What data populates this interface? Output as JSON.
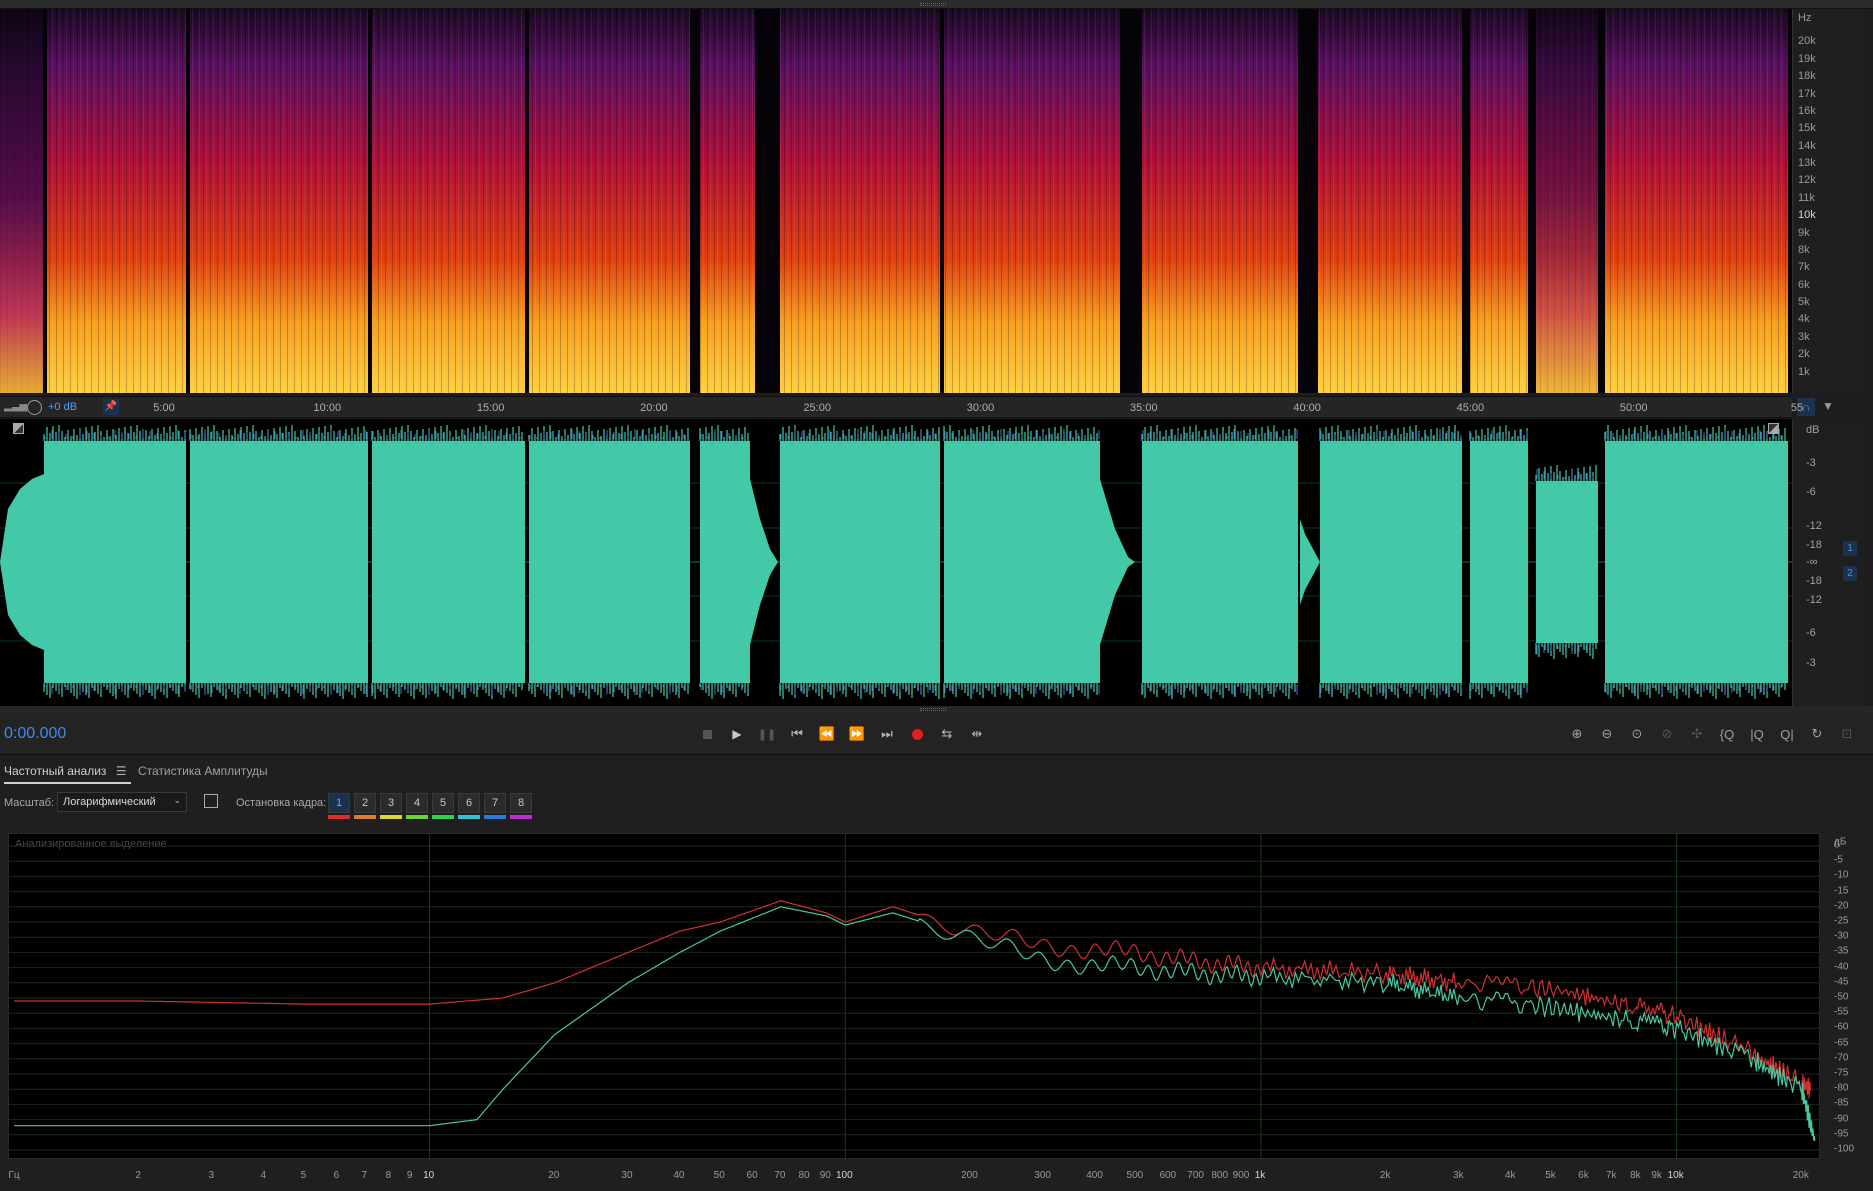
{
  "spectral_view": {
    "hz_unit": "Hz",
    "hz_ticks": [
      "20k",
      "19k",
      "18k",
      "17k",
      "16k",
      "15k",
      "14k",
      "13k",
      "12k",
      "11k",
      "10k",
      "9k",
      "8k",
      "7k",
      "6k",
      "5k",
      "4k",
      "3k",
      "2k",
      "1k"
    ]
  },
  "timeline": {
    "gain_label": "+0 dB",
    "ticks": [
      "5:00",
      "10:00",
      "15:00",
      "20:00",
      "25:00",
      "30:00",
      "35:00",
      "40:00",
      "45:00",
      "50:00",
      "55"
    ]
  },
  "waveform": {
    "db_unit": "dB",
    "db_ticks": [
      "-3",
      "-6",
      "-12",
      "-18",
      "-∞",
      "-18",
      "-12",
      "-6",
      "-3"
    ],
    "channels": [
      "1",
      "2"
    ],
    "color": "#43c8a8"
  },
  "transport": {
    "current_time": "0:00.000",
    "buttons": [
      "stop-icon",
      "play-icon",
      "pause-icon",
      "go-to-start-icon",
      "rewind-icon",
      "fast-forward-icon",
      "go-to-end-icon",
      "record-icon",
      "loop-icon",
      "skip-selection-icon"
    ],
    "zoom_buttons": [
      "zoom-in-amplitude-icon",
      "zoom-out-amplitude-icon",
      "zoom-full-icon",
      "zoom-in-time-icon",
      "zoom-out-time-icon",
      "zoom-out-full-icon",
      "zoom-in-at-start-icon",
      "zoom-in-at-end-icon",
      "zoom-to-selection-icon",
      "zoom-tool-icon",
      "zoom-reset-icon"
    ]
  },
  "analysis_panel": {
    "tabs": [
      "Частотный анализ",
      "Статистика Амплитуды"
    ],
    "scale_label": "Масштаб:",
    "scale_value": "Логарифмический",
    "freeze_label": "Остановка кадра:",
    "frames": [
      "1",
      "2",
      "3",
      "4",
      "5",
      "6",
      "7",
      "8"
    ],
    "frame_colors": [
      "#e02b2b",
      "#e07a2b",
      "#e0d62b",
      "#6ad62b",
      "#2bd64a",
      "#2bc6d6",
      "#2b7ae0",
      "#c02bd6"
    ]
  },
  "chart_data": {
    "type": "line",
    "title": "Анализированное выделение",
    "xlabel": "Гц",
    "ylabel": "дБ",
    "x_scale": "log",
    "xlim": [
      1,
      22000
    ],
    "ylim": [
      -100,
      0
    ],
    "x_ticks": [
      "Гц",
      "2",
      "3",
      "4",
      "5",
      "6",
      "7",
      "8",
      "9",
      "10",
      "20",
      "30",
      "40",
      "50",
      "60",
      "70",
      "80",
      "90",
      "100",
      "200",
      "300",
      "400",
      "500",
      "600",
      "700",
      "800",
      "900",
      "1k",
      "2k",
      "3k",
      "4k",
      "5k",
      "6k",
      "7k",
      "8k",
      "9k",
      "10k",
      "20k"
    ],
    "y_ticks": [
      "дБ",
      "0",
      "-5",
      "-10",
      "-15",
      "-20",
      "-25",
      "-30",
      "-35",
      "-40",
      "-45",
      "-50",
      "-55",
      "-60",
      "-65",
      "-70",
      "-75",
      "-80",
      "-85",
      "-90",
      "-95",
      "-100"
    ],
    "grid": true,
    "series": [
      {
        "color": "#d03030",
        "x": [
          1,
          2,
          5,
          10,
          15,
          20,
          30,
          40,
          50,
          70,
          90,
          100,
          130,
          200,
          300,
          500,
          700,
          1000,
          2000,
          3000,
          5000,
          8000,
          10000,
          15000,
          20000,
          21000
        ],
        "y": [
          -51,
          -51,
          -52,
          -52,
          -50,
          -45,
          -35,
          -28,
          -25,
          -18,
          -22,
          -25,
          -20,
          -28,
          -33,
          -35,
          -38,
          -40,
          -42,
          -45,
          -47,
          -53,
          -56,
          -68,
          -78,
          -80
        ]
      },
      {
        "color": "#48c8a0",
        "x": [
          1,
          2,
          5,
          10,
          13,
          15,
          20,
          30,
          40,
          50,
          70,
          90,
          100,
          130,
          200,
          300,
          500,
          700,
          1000,
          2000,
          3000,
          5000,
          8000,
          10000,
          15000,
          20000,
          21500
        ],
        "y": [
          -92,
          -92,
          -92,
          -92,
          -90,
          -80,
          -62,
          -45,
          -35,
          -28,
          -20,
          -23,
          -26,
          -22,
          -30,
          -38,
          -40,
          -42,
          -43,
          -45,
          -50,
          -53,
          -58,
          -60,
          -70,
          -80,
          -97
        ]
      }
    ]
  }
}
